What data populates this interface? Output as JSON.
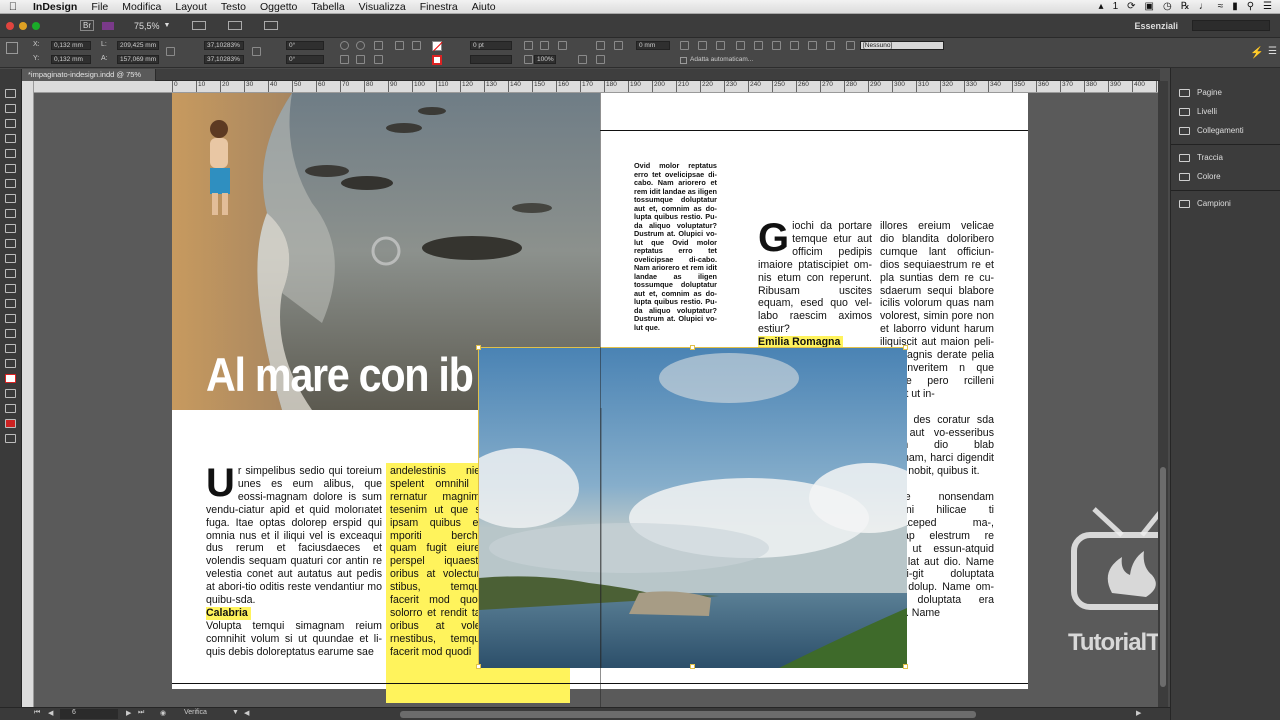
{
  "menubar": {
    "app": "InDesign",
    "items": [
      "File",
      "Modifica",
      "Layout",
      "Testo",
      "Oggetto",
      "Tabella",
      "Visualizza",
      "Finestra",
      "Aiuto"
    ],
    "right": {
      "badge": "1"
    }
  },
  "appbar": {
    "br": "Br",
    "zoom": "75,5%",
    "workspace": "Essenziali",
    "search_placeholder": ""
  },
  "control": {
    "x": "0,132 mm",
    "y": "0,132 mm",
    "w": "209,425 mm",
    "h": "157,069 mm",
    "scale_x": "37,10283%",
    "scale_y": "37,10283%",
    "angle": "0°",
    "shear": "0°",
    "stroke": "0 pt",
    "pct": "100%",
    "offset": "0 mm",
    "autofit": "Adatta automaticam...",
    "style": "[Nessuno]"
  },
  "doc_tab": "*impaginato-indesign.indd @ 75%",
  "ruler": {
    "ticks": [
      "0",
      "10",
      "20",
      "30",
      "40",
      "50",
      "60",
      "70",
      "80",
      "90",
      "100",
      "110",
      "120",
      "130",
      "140",
      "150",
      "160",
      "170",
      "180",
      "190",
      "200",
      "210",
      "220",
      "230",
      "240",
      "250",
      "260",
      "270",
      "280",
      "290",
      "300",
      "310",
      "320",
      "330",
      "340",
      "350",
      "360",
      "370",
      "380",
      "390",
      "400",
      "410",
      "420",
      "430"
    ]
  },
  "panels": [
    "Pagine",
    "Livelli",
    "Collegamenti",
    "Traccia",
    "Colore",
    "Campioni"
  ],
  "status": {
    "page": "6",
    "preflight": "Verifica"
  },
  "spread": {
    "headline": "Al mare con ib",
    "left_body_cap": "U",
    "left_body": "r simpelibus sedio qui toreium unes es eum alibus, que eossi-magnam dolore is sum vendu-ciatur apid et quid molorıatet fuga. Itae optas dolorep erspid qui omnia nus et il iliqui vel is exceaqui dus rerum et faciusdaeces et volendis sequam quaturi cor antin re velestia conet aut autatus aut pedis at abori-tio oditis reste vendantiur mo quibu-sda.",
    "left_sub": "Calabria",
    "left_body2": "Volupta temqui simagnam reium comnihit volum si ut quundae et li-quis debis doloreptatus earume sae",
    "mid_body": "andelestinis nien spelent omnihil e rernatur magnimu tesenim ut que sit ipsam quibus eic mporiti berchit, quam fugit eiuren perspel iquaestis oribus at volectur? stibus, temque facerit mod quodi solorro et rendit tas oribus at volec rnestibus, temque facerit mod quodi",
    "right_small": "Ovid molor reptatus erro tet ovelicipsae di-cabo. Nam ariorero et rem idit landae as iligen tossumque doluptatur aut et, comnim as do-lupta quibus restio. Pu-da aliquo voluptatur? Dustrum at. Olupici vo-lut que Ovid molor reptatus erro tet ovelicipsae di-cabo. Nam ariorero et rem idit landae as iligen tossumque doluptatur aut et, comnim as do-lupta quibus restio. Pu-da aliquo voluptatur? Dustrum at. Olupici vo-lut que.",
    "right_cap": "G",
    "right_col1": "iochi da portare temque etur aut officim pedipis imaiore ptatiscipiet om-nis etum con reperunt. Ribusam uscites equam, esed quo vel-labo raescim aximos estiur?",
    "right_sub1": "Emilia Romagna",
    "right_col2": "illores ereium velicae dio blandita doloribero cumque lant officiun-dios sequiaestrum re et pla suntias dem re cu-sdaerum sequi blabore icilis volorum quas nam volorest, simin pore non et laborro vidunt harum iliquiscit aut maion peli-mil magnis derate pelia vel inveritem n que nullore pero rcilleni sandit ut in-",
    "right_col2b": "m es des coratur sda sunt aut vo-esseribus sinum dio blab imagnam, harci digendit qui s, nobit, quibus it.",
    "right_sub2": "ana",
    "right_col2c": "vipsae nonsendam santeni hilicae ti nvellaceped ma-, tetusap elestrum re dem ut essun-atquid blam lat aut dio. Name omnhi-git doluptata plaut dolup. Name om-fugit doluptata era dolup. Name"
  },
  "watermark": "TutorialTV"
}
